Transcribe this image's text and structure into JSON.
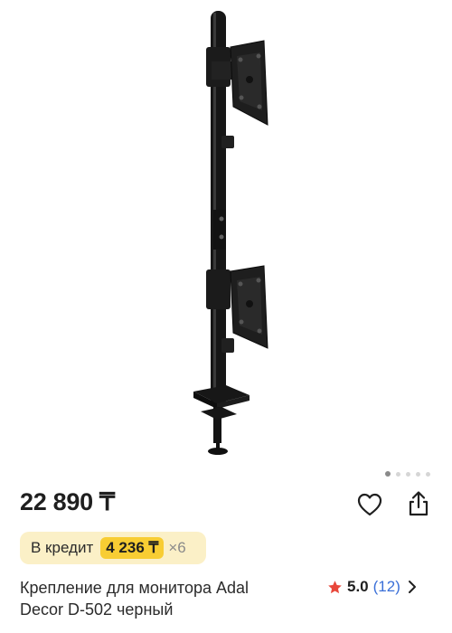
{
  "product": {
    "price": "22 890 ₸",
    "title_line1": "Крепление для монитора Adal",
    "title_line2": "Decor D-502 черный",
    "image": {
      "alt": "Крепление для монитора Adal Decor D-502 черный",
      "image_count": 5,
      "active_index": 0
    }
  },
  "credit": {
    "label": "В кредит",
    "amount": "4 236 ₸",
    "term": "×6"
  },
  "rating": {
    "score": "5.0",
    "count": "(12)"
  },
  "icons": {
    "favorite": "heart-outline-icon",
    "share": "share-icon",
    "star": "star-icon",
    "chevron": "chevron-right-icon"
  },
  "colors": {
    "credit_bg": "#fbf0c7",
    "credit_highlight": "#f8cd33",
    "star": "#e8473b",
    "count_link": "#3a6fd8"
  }
}
